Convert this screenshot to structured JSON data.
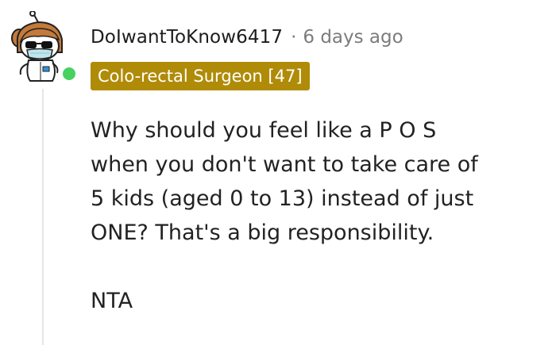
{
  "comment": {
    "author": "DoIwantToKnow6417",
    "separator": "·",
    "timestamp": "6 days ago",
    "flair": "Colo-rectal Surgeon [47]",
    "body_lines": [
      "Why should you feel like a P O S",
      "when you don't want to take care of",
      "5 kids (aged 0 to 13) instead of just",
      "ONE? That's a big responsibility."
    ],
    "verdict": "NTA"
  },
  "colors": {
    "flair_background": "#b08b08",
    "online_indicator": "#46d160",
    "thread_line": "#e6e6e6",
    "meta_text": "#7c7c7c"
  },
  "icons": {
    "avatar": "snoo-avatar-icon",
    "online": "online-status-icon"
  }
}
